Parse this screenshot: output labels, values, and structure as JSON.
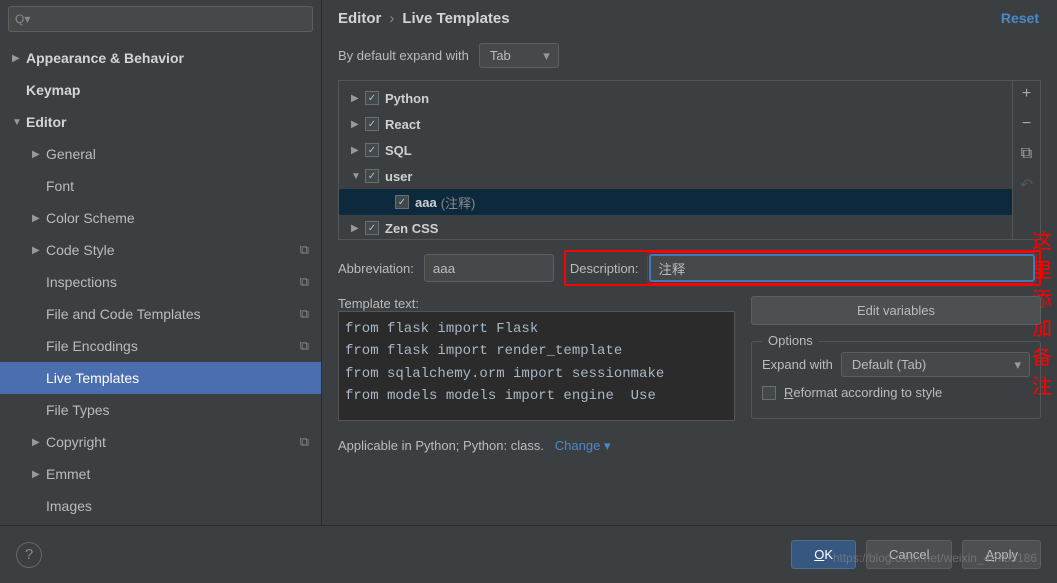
{
  "breadcrumb": {
    "parent": "Editor",
    "current": "Live Templates"
  },
  "reset": "Reset",
  "expand": {
    "label": "By default expand with",
    "value": "Tab"
  },
  "sidebar": {
    "items": [
      {
        "label": "Appearance & Behavior",
        "arrow": "▶",
        "bold": true,
        "indent": 0
      },
      {
        "label": "Keymap",
        "arrow": "",
        "bold": true,
        "indent": 0
      },
      {
        "label": "Editor",
        "arrow": "▼",
        "bold": true,
        "indent": 0
      },
      {
        "label": "General",
        "arrow": "▶",
        "bold": false,
        "indent": 1
      },
      {
        "label": "Font",
        "arrow": "",
        "bold": false,
        "indent": 1
      },
      {
        "label": "Color Scheme",
        "arrow": "▶",
        "bold": false,
        "indent": 1
      },
      {
        "label": "Code Style",
        "arrow": "▶",
        "bold": false,
        "indent": 1,
        "copy": true
      },
      {
        "label": "Inspections",
        "arrow": "",
        "bold": false,
        "indent": 1,
        "copy": true
      },
      {
        "label": "File and Code Templates",
        "arrow": "",
        "bold": false,
        "indent": 1,
        "copy": true
      },
      {
        "label": "File Encodings",
        "arrow": "",
        "bold": false,
        "indent": 1,
        "copy": true
      },
      {
        "label": "Live Templates",
        "arrow": "",
        "bold": false,
        "indent": 1,
        "selected": true
      },
      {
        "label": "File Types",
        "arrow": "",
        "bold": false,
        "indent": 1
      },
      {
        "label": "Copyright",
        "arrow": "▶",
        "bold": false,
        "indent": 1,
        "copy": true
      },
      {
        "label": "Emmet",
        "arrow": "▶",
        "bold": false,
        "indent": 1
      },
      {
        "label": "Images",
        "arrow": "",
        "bold": false,
        "indent": 1
      }
    ]
  },
  "templates": [
    {
      "arrow": "▶",
      "name": "Python"
    },
    {
      "arrow": "▶",
      "name": "React"
    },
    {
      "arrow": "▶",
      "name": "SQL"
    },
    {
      "arrow": "▼",
      "name": "user",
      "expanded": true
    },
    {
      "child": true,
      "name": "aaa",
      "desc": "(注释)",
      "selected": true
    },
    {
      "arrow": "▶",
      "name": "Zen CSS"
    }
  ],
  "annotation": "这里添加备注",
  "abbrev": {
    "label": "Abbreviation:",
    "value": "aaa"
  },
  "description": {
    "label": "Description:",
    "value": "注释"
  },
  "template_text": {
    "label": "Template text:",
    "value": "from flask import Flask\nfrom flask import render_template\nfrom sqlalchemy.orm import sessionmake\nfrom models models import engine  Use"
  },
  "edit_variables": "Edit variables",
  "options": {
    "title": "Options",
    "expand_with": {
      "label": "Expand with",
      "value": "Default (Tab)"
    },
    "reformat": "Reformat according to style"
  },
  "applicable": {
    "text": "Applicable in Python; Python: class.",
    "change": "Change"
  },
  "footer": {
    "ok": "OK",
    "cancel": "Cancel",
    "apply": "Apply"
  },
  "watermark": "https://blog.csdn.net/weixin_48755186"
}
